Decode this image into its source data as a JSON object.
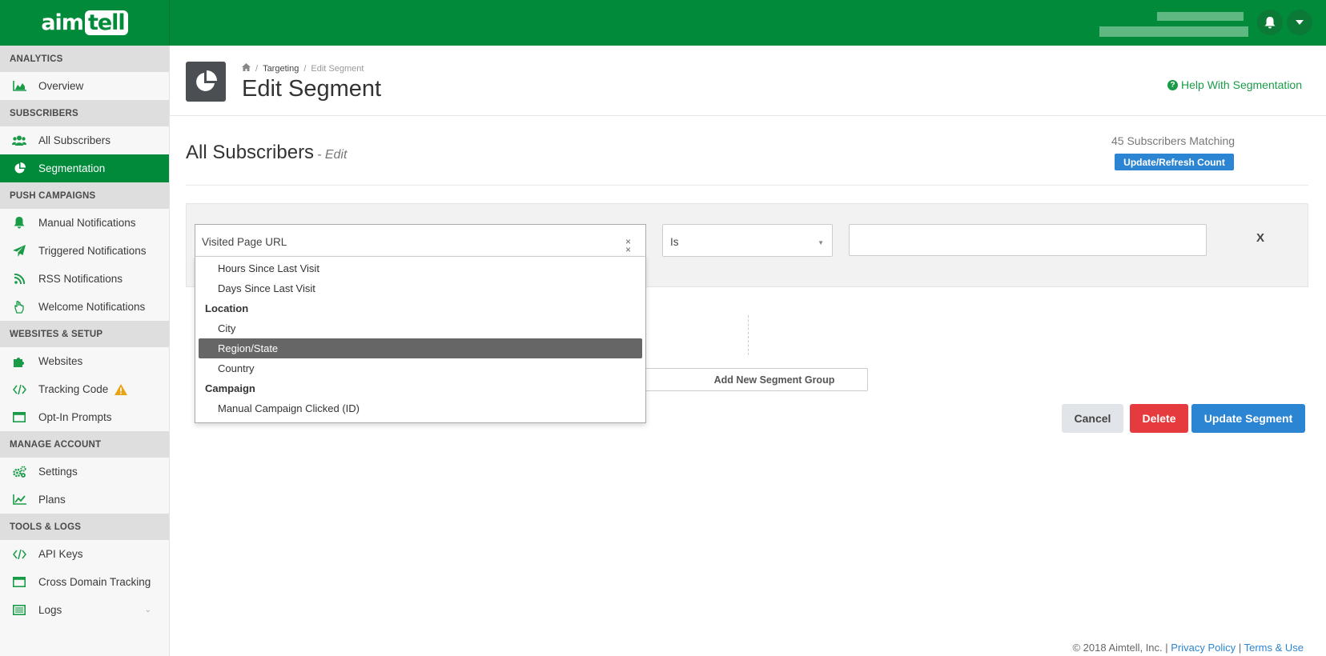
{
  "brand": {
    "name_part1": "aim",
    "name_part2": "tell",
    "color": "#008a3a"
  },
  "topbar": {
    "icons": [
      "bell-icon",
      "caret-down-icon"
    ]
  },
  "sidebar": {
    "sections": [
      {
        "title": "ANALYTICS",
        "items": [
          {
            "label": "Overview",
            "icon": "area-chart-icon"
          }
        ]
      },
      {
        "title": "SUBSCRIBERS",
        "items": [
          {
            "label": "All Subscribers",
            "icon": "users-icon"
          },
          {
            "label": "Segmentation",
            "icon": "pie-chart-icon",
            "active": true
          }
        ]
      },
      {
        "title": "PUSH CAMPAIGNS",
        "items": [
          {
            "label": "Manual Notifications",
            "icon": "bell-icon"
          },
          {
            "label": "Triggered Notifications",
            "icon": "paper-plane-icon"
          },
          {
            "label": "RSS Notifications",
            "icon": "rss-icon"
          },
          {
            "label": "Welcome Notifications",
            "icon": "hand-wave-icon"
          }
        ]
      },
      {
        "title": "WEBSITES & SETUP",
        "items": [
          {
            "label": "Websites",
            "icon": "puzzle-icon"
          },
          {
            "label": "Tracking Code",
            "icon": "code-icon",
            "warning": true
          },
          {
            "label": "Opt-In Prompts",
            "icon": "window-icon"
          }
        ]
      },
      {
        "title": "MANAGE ACCOUNT",
        "items": [
          {
            "label": "Settings",
            "icon": "gears-icon"
          },
          {
            "label": "Plans",
            "icon": "line-chart-icon"
          }
        ]
      },
      {
        "title": "TOOLS & LOGS",
        "items": [
          {
            "label": "API Keys",
            "icon": "code-icon"
          },
          {
            "label": "Cross Domain Tracking",
            "icon": "window-icon"
          },
          {
            "label": "Logs",
            "icon": "list-icon",
            "chevron": true
          }
        ]
      }
    ]
  },
  "header": {
    "breadcrumb": {
      "home_icon": "home-icon",
      "link": "Targeting",
      "current": "Edit Segment",
      "separator": "/"
    },
    "title": "Edit Segment",
    "help_link": "Help With Segmentation"
  },
  "segment": {
    "name": "All Subscribers",
    "edit_suffix": "- Edit",
    "matching_text": "45 Subscribers Matching",
    "refresh_label": "Update/Refresh Count"
  },
  "rule": {
    "field_value": "Visited Page URL",
    "clear_symbol": "×",
    "operator_value": "Is",
    "operator_arrow": "▼",
    "value_input": "",
    "remove_symbol": "X"
  },
  "dropdown": {
    "options": [
      {
        "type": "option",
        "label": "Hours Since Last Visit"
      },
      {
        "type": "option",
        "label": "Days Since Last Visit"
      },
      {
        "type": "group",
        "label": "Location"
      },
      {
        "type": "option",
        "label": "City"
      },
      {
        "type": "option",
        "label": "Region/State",
        "highlighted": true
      },
      {
        "type": "option",
        "label": "Country"
      },
      {
        "type": "group",
        "label": "Campaign"
      },
      {
        "type": "option",
        "label": "Manual Campaign Clicked (ID)"
      }
    ]
  },
  "add_group_label": "Add New Segment Group",
  "actions": {
    "cancel": "Cancel",
    "delete": "Delete",
    "update": "Update Segment"
  },
  "footer": {
    "copyright": "© 2018 Aimtell, Inc. |",
    "privacy": "Privacy Policy",
    "sep": "|",
    "terms": "Terms & Use"
  }
}
